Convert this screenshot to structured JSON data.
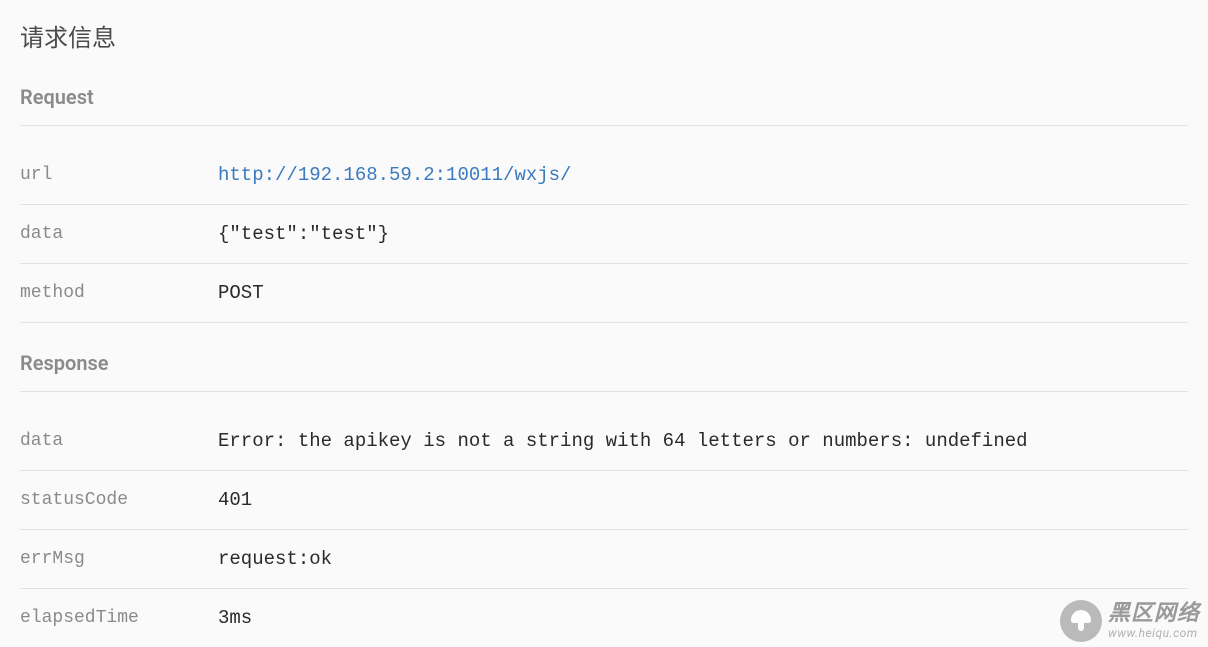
{
  "title": "请求信息",
  "request": {
    "heading": "Request",
    "rows": {
      "url": {
        "key": "url",
        "value": "http://192.168.59.2:10011/wxjs/"
      },
      "data": {
        "key": "data",
        "value": "{\"test\":\"test\"}"
      },
      "method": {
        "key": "method",
        "value": "POST"
      }
    }
  },
  "response": {
    "heading": "Response",
    "rows": {
      "data": {
        "key": "data",
        "value": "Error: the apikey is not a string with 64 letters or numbers: undefined"
      },
      "statusCode": {
        "key": "statusCode",
        "value": "401"
      },
      "errMsg": {
        "key": "errMsg",
        "value": "request:ok"
      },
      "elapsedTime": {
        "key": "elapsedTime",
        "value": "3ms"
      }
    }
  },
  "watermark": {
    "main": "黑区网络",
    "sub": "www.heiqu.com"
  }
}
